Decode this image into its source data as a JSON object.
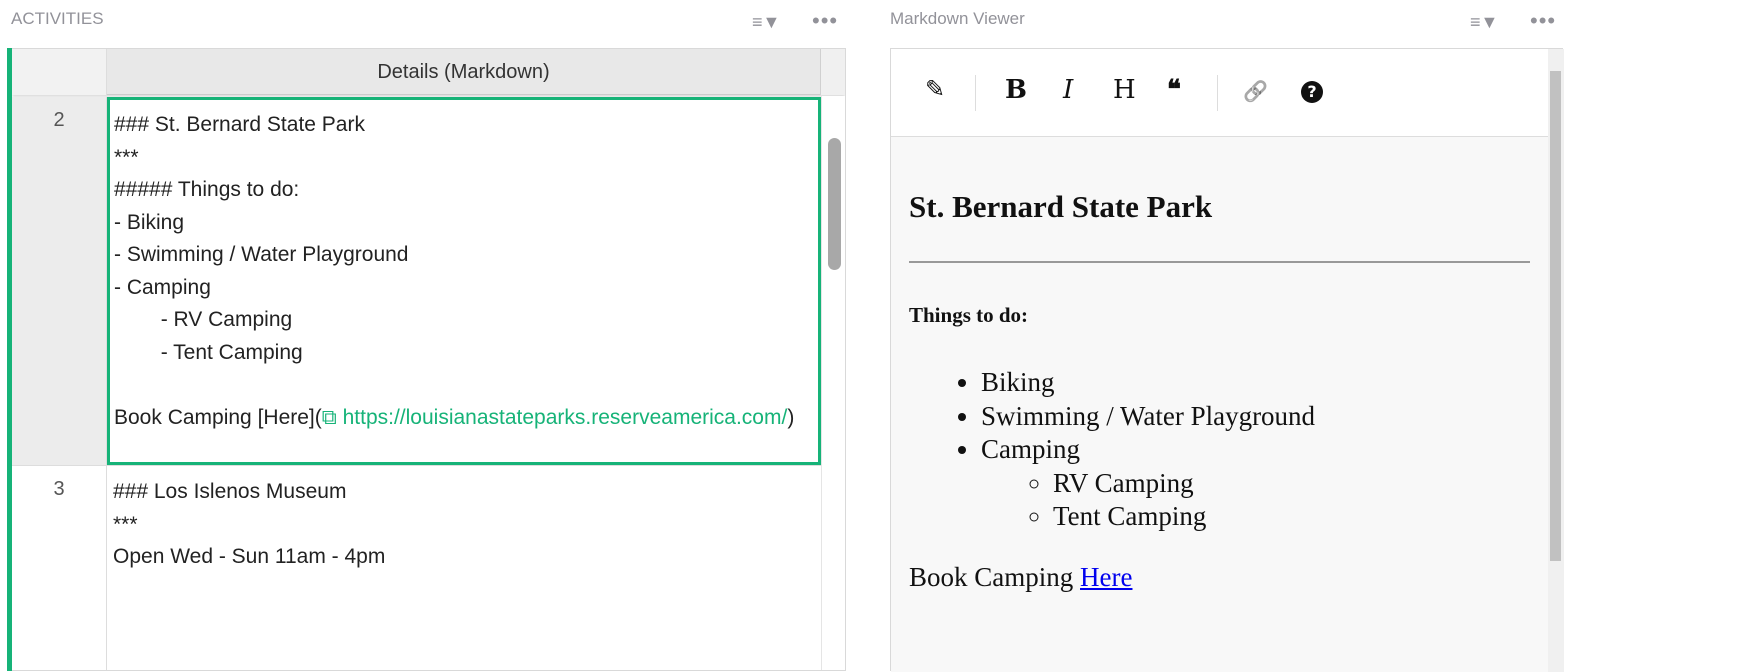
{
  "left_panel": {
    "title": "ACTIVITIES",
    "column_header": "Details (Markdown)",
    "rows": [
      {
        "num": "2",
        "lines": [
          "### St. Bernard State Park",
          "***",
          "##### Things to do:",
          "- Biking",
          "- Swimming / Water Playground",
          "- Camping",
          "        - RV Camping",
          "        - Tent Camping",
          "",
          "Book Camping [Here]("
        ],
        "link": "https://louisianastateparks.reserveamerica.com/",
        "tail": ")"
      },
      {
        "num": "3",
        "lines": [
          "### Los Islenos Museum",
          "***",
          "Open Wed - Sun 11am - 4pm"
        ]
      }
    ]
  },
  "right_panel": {
    "title": "Markdown Viewer",
    "toolbar": {
      "edit": "✎",
      "bold": "B",
      "italic": "I",
      "heading": "H",
      "quote": "❝",
      "link": "🔗",
      "help": "?"
    },
    "content": {
      "heading": "St. Bernard State Park",
      "subheading": "Things to do:",
      "items": [
        "Biking",
        "Swimming / Water Playground",
        "Camping"
      ],
      "subitems": [
        "RV Camping",
        "Tent Camping"
      ],
      "book_text": "Book Camping ",
      "book_link": "Here"
    }
  },
  "colors": {
    "accent": "#16b378"
  }
}
